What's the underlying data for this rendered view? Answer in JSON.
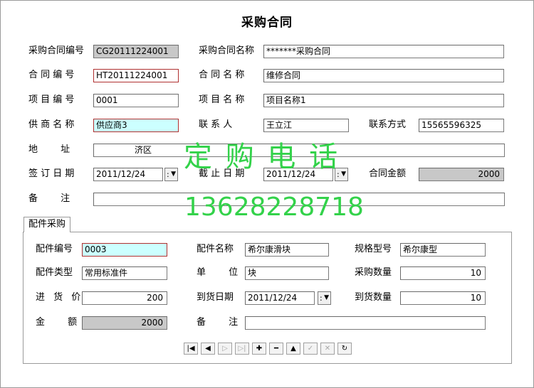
{
  "window": {
    "title": "采购合同"
  },
  "contract": {
    "no_label": "采购合同编号",
    "no_value": "CG20111224001",
    "name_label": "采购合同名称",
    "name_value": "*******采购合同",
    "hetong_no_label": "合 同 编 号",
    "hetong_no_value": "HT20111224001",
    "hetong_name_label": "合 同 名 称",
    "hetong_name_value": "维修合同",
    "project_no_label": "项 目 编 号",
    "project_no_value": "0001",
    "project_name_label": "项 目 名 称",
    "project_name_value": "项目名称1",
    "supplier_label": "供 商 名 称",
    "supplier_value": "供应商3",
    "contact_label": "联 系 人",
    "contact_value": "王立江",
    "phone_label": "联系方式",
    "phone_value": "15565596325",
    "address_label": "地 址",
    "address_value": "济区",
    "sign_date_label": "签 订 日 期",
    "sign_date_value": "2011/12/24",
    "end_date_label": "截 止 日 期",
    "end_date_value": "2011/12/24",
    "amount_label": "合同金额",
    "amount_value": "2000",
    "remark_label": "备 注",
    "remark_value": ""
  },
  "tab": {
    "label": "配件采购"
  },
  "parts": {
    "no_label": "配件编号",
    "no_value": "0003",
    "name_label": "配件名称",
    "name_value": "希尔康滑块",
    "spec_label": "规格型号",
    "spec_value": "希尔康型",
    "type_label": "配件类型",
    "type_value": "常用标准件",
    "unit_label": "单 位",
    "unit_value": "块",
    "qty_label": "采购数量",
    "qty_value": "10",
    "price_label": "进 货 价",
    "price_value": "200",
    "arrive_date_label": "到货日期",
    "arrive_date_value": "2011/12/24",
    "arrive_qty_label": "到货数量",
    "arrive_qty_value": "10",
    "money_label": "金 额",
    "money_value": "2000",
    "remark_label": "备 注",
    "remark_value": ""
  },
  "navigator": {
    "first": "|◀",
    "prior": "◀",
    "next": "▷",
    "last": "▷|",
    "insert": "✚",
    "delete": "━",
    "edit": "▲",
    "post": "✓",
    "cancel": "✕",
    "refresh": "↻"
  },
  "watermark": {
    "line1": "定 购 电 话",
    "line2": "13628228718"
  },
  "colors": {
    "readonly_bg": "#c8c8c8",
    "highlight_bg": "#ccffff",
    "required_border": "#b03030",
    "watermark": "#33d24a"
  }
}
